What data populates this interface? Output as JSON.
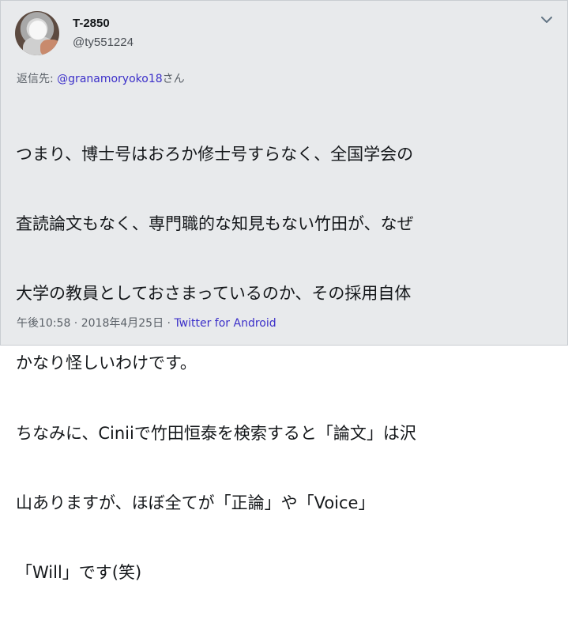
{
  "user": {
    "display_name": "T-2850",
    "handle": "@ty551224"
  },
  "reply": {
    "prefix": "返信先: ",
    "mention": "@granamoryoko18",
    "suffix": "さん"
  },
  "tweet": {
    "lines": [
      "つまり、博士号はおろか修士号すらなく、全国学会の",
      "査読論文もなく、専門職的な知見もない竹田が、なぜ",
      "大学の教員としておさまっているのか、その採用自体",
      "かなり怪しいわけです。",
      "ちなみに、Ciniiで竹田恒泰を検索すると「論文」は沢",
      "山ありますが、ほぼ全てが「正論」や「Voice」",
      "「Will」です(笑)"
    ]
  },
  "meta": {
    "time": "午後10:58",
    "separator1": " · ",
    "date": "2018年4月25日",
    "separator2": " · ",
    "source": "Twitter for Android"
  },
  "icons": {
    "more": "chevron-down-icon"
  },
  "colors": {
    "link": "#3b2fc9",
    "secondary_text": "#5b6168",
    "background": "#e8eaec"
  }
}
